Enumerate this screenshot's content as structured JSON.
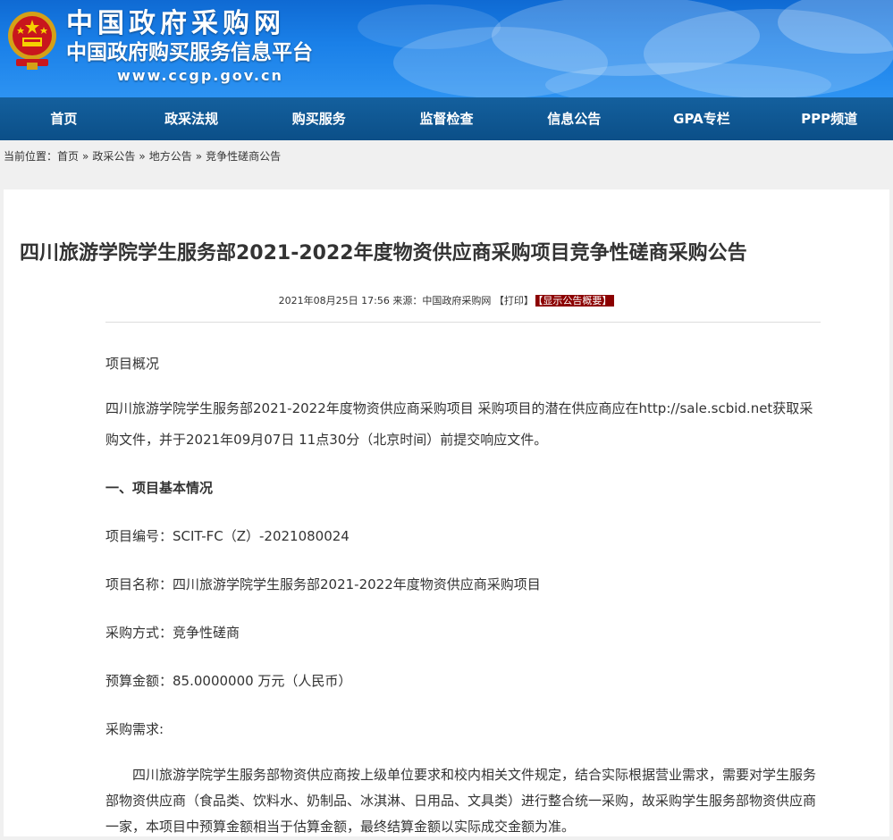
{
  "header": {
    "site_title": "中国政府采购网",
    "site_subtitle": "中国政府购买服务信息平台",
    "url": "www.ccgp.gov.cn"
  },
  "nav": {
    "items": [
      "首页",
      "政采法规",
      "购买服务",
      "监督检查",
      "信息公告",
      "GPA专栏",
      "PPP频道"
    ]
  },
  "breadcrumb": {
    "label": "当前位置：",
    "items": [
      "首页",
      "政采公告",
      "地方公告",
      "竞争性磋商公告"
    ],
    "separator": "»"
  },
  "article": {
    "title": "四川旅游学院学生服务部2021-2022年度物资供应商采购项目竞争性磋商采购公告",
    "meta": "2021年08月25日 17:56 来源：中国政府采购网 【打印】",
    "summary_badge": "【显示公告概要】",
    "section_overview": "项目概况",
    "overview_text": "四川旅游学院学生服务部2021-2022年度物资供应商采购项目 采购项目的潜在供应商应在http://sale.scbid.net获取采购文件，并于2021年09月07日 11点30分（北京时间）前提交响应文件。",
    "section_basic": "一、项目基本情况",
    "project_no": "项目编号：SCIT-FC（Z）-2021080024",
    "project_name": "项目名称：四川旅游学院学生服务部2021-2022年度物资供应商采购项目",
    "method": "采购方式：竞争性磋商",
    "budget": "预算金额：85.0000000 万元（人民币）",
    "demand_label": "采购需求:",
    "demand_text": "四川旅游学院学生服务部物资供应商按上级单位要求和校内相关文件规定，结合实际根据营业需求，需要对学生服务部物资供应商（食品类、饮料水、奶制品、冰淇淋、日用品、文具类）进行整合统一采购，故采购学生服务部物资供应商一家，本项目中预算金额相当于估算金额，最终结算金额以实际成交金额为准。"
  },
  "colors": {
    "header_blue": "#1a80e8",
    "nav_blue": "#0b4f88",
    "badge_red": "#8b0000"
  }
}
